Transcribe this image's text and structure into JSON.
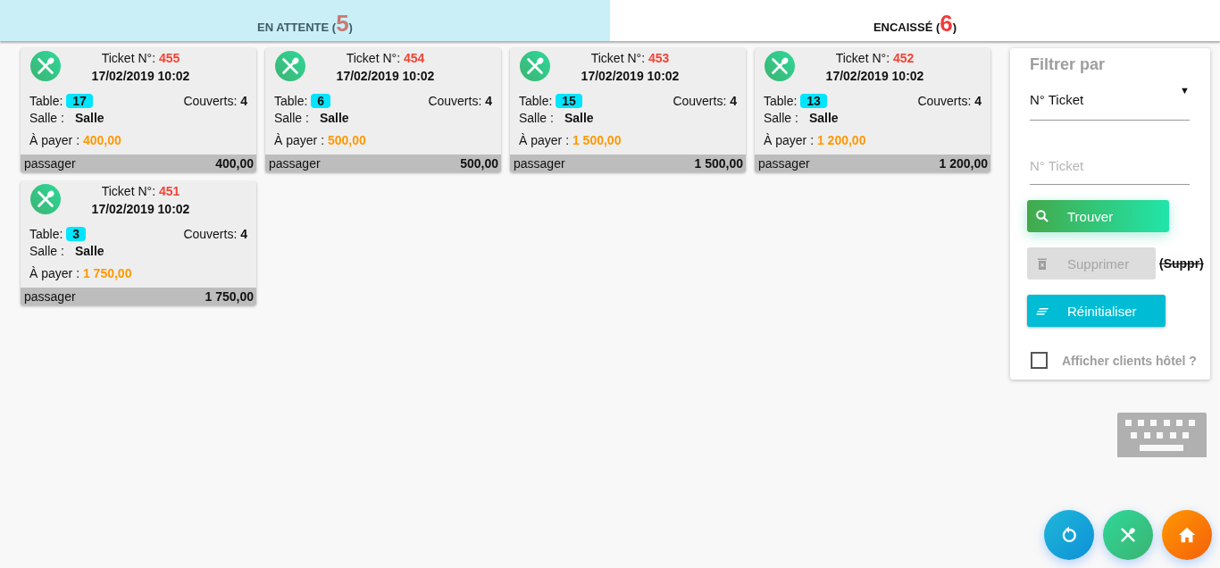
{
  "tabs": [
    {
      "label": "EN ATTENTE (",
      "count": "5",
      "suffix": ")",
      "selected": true
    },
    {
      "label": "ENCAISSÉ (",
      "count": "6",
      "suffix": ")",
      "selected": false
    }
  ],
  "tickets": [
    {
      "ticket_label": "Ticket N°:",
      "number": "455",
      "date": "17/02/2019 10:02",
      "table_label": "Table:",
      "table": "17",
      "covers_label": "Couverts:",
      "covers": "4",
      "room_label": "Salle :",
      "room": "Salle",
      "pay_label": "À payer :",
      "amount": "400,00",
      "client": "passager",
      "total": "400,00"
    },
    {
      "ticket_label": "Ticket N°:",
      "number": "454",
      "date": "17/02/2019 10:02",
      "table_label": "Table:",
      "table": "6",
      "covers_label": "Couverts:",
      "covers": "4",
      "room_label": "Salle :",
      "room": "Salle",
      "pay_label": "À payer :",
      "amount": "500,00",
      "client": "passager",
      "total": "500,00"
    },
    {
      "ticket_label": "Ticket N°:",
      "number": "453",
      "date": "17/02/2019 10:02",
      "table_label": "Table:",
      "table": "15",
      "covers_label": "Couverts:",
      "covers": "4",
      "room_label": "Salle :",
      "room": "Salle",
      "pay_label": "À payer :",
      "amount": "1 500,00",
      "client": "passager",
      "total": "1 500,00"
    },
    {
      "ticket_label": "Ticket N°:",
      "number": "452",
      "date": "17/02/2019 10:02",
      "table_label": "Table:",
      "table": "13",
      "covers_label": "Couverts:",
      "covers": "4",
      "room_label": "Salle :",
      "room": "Salle",
      "pay_label": "À payer :",
      "amount": "1 200,00",
      "client": "passager",
      "total": "1 200,00"
    },
    {
      "ticket_label": "Ticket N°:",
      "number": "451",
      "date": "17/02/2019 10:02",
      "table_label": "Table:",
      "table": "3",
      "covers_label": "Couverts:",
      "covers": "4",
      "room_label": "Salle :",
      "room": "Salle",
      "pay_label": "À payer :",
      "amount": "1 750,00",
      "client": "passager",
      "total": "1 750,00"
    }
  ],
  "filter": {
    "title": "Filtrer par",
    "select_value": "N° Ticket",
    "select_arrow": "▼",
    "input_placeholder": "N° Ticket",
    "buttons": [
      {
        "kind": "search",
        "label": "Trouver",
        "disabled": false
      },
      {
        "kind": "delete",
        "label": "Supprimer",
        "disabled": true,
        "shortcut": "(Suppr)"
      },
      {
        "kind": "reset",
        "label": "Réinitialiser",
        "disabled": false
      }
    ],
    "checkbox": {
      "label": "Afficher clients hôtel ?",
      "checked": false
    }
  }
}
